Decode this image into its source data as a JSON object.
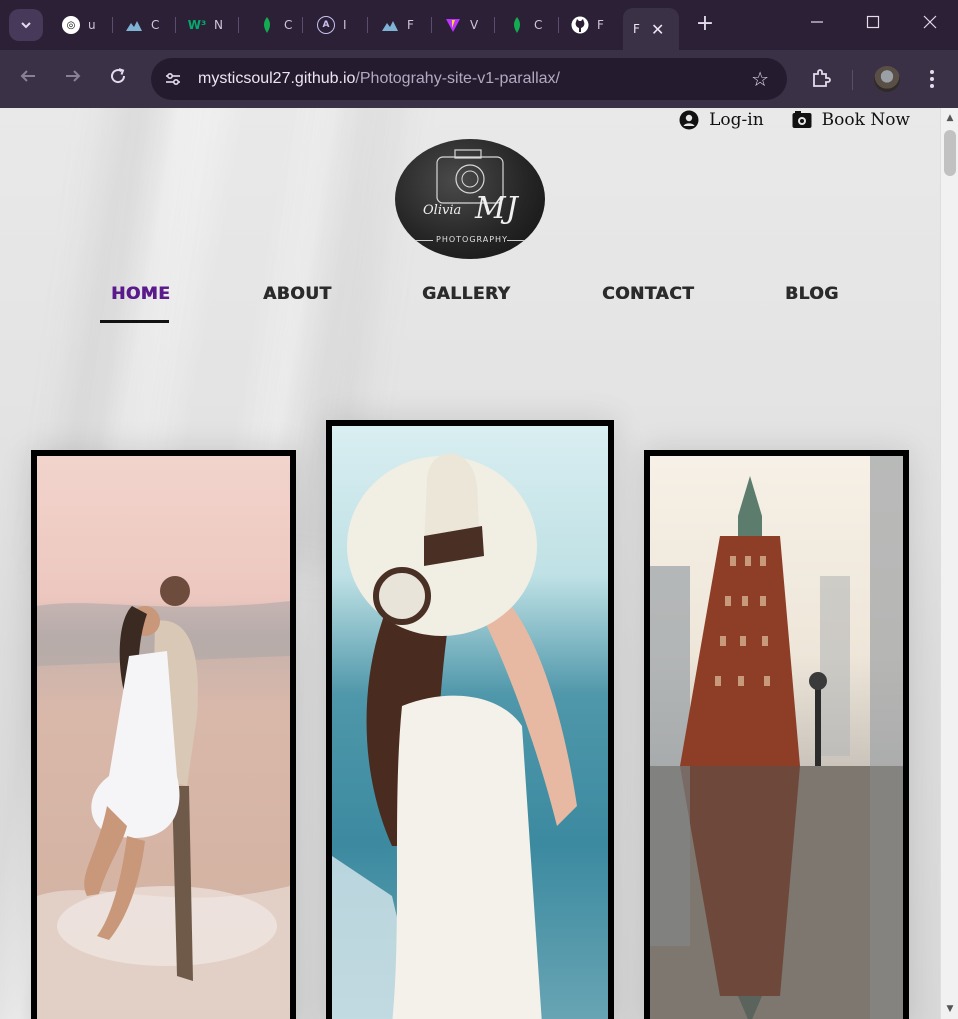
{
  "browser": {
    "tabs": [
      {
        "title": "u",
        "icon": "openai-icon",
        "color": "#ffffff"
      },
      {
        "title": "C",
        "icon": "mountain-icon",
        "color": "#7fb3d5"
      },
      {
        "title": "N",
        "icon": "w3-icon",
        "color": "#04aa6d"
      },
      {
        "title": "C",
        "icon": "mongodb-icon",
        "color": "#13aa52"
      },
      {
        "title": "I",
        "icon": "angular-icon",
        "color": "#c8c0f0"
      },
      {
        "title": "F",
        "icon": "mountain-icon",
        "color": "#7fb3d5"
      },
      {
        "title": "V",
        "icon": "vite-icon",
        "color": "#bd34fe"
      },
      {
        "title": "C",
        "icon": "mongodb-icon",
        "color": "#13aa52"
      },
      {
        "title": "F",
        "icon": "github-icon",
        "color": "#ffffff"
      }
    ],
    "active_tab_title": "F",
    "url_host": "mysticsoul27.github.io",
    "url_path": "/Photograhy-site-v1-parallax/"
  },
  "site": {
    "login_label": "Log-in",
    "book_label": "Book Now",
    "logo": {
      "script_name": "Olivia",
      "initials": "MJ",
      "tagline": "PHOTOGRAPHY"
    },
    "nav": [
      {
        "label": "HOME",
        "active": true
      },
      {
        "label": "ABOUT",
        "active": false
      },
      {
        "label": "GALLERY",
        "active": false
      },
      {
        "label": "CONTACT",
        "active": false
      },
      {
        "label": "BLOG",
        "active": false
      }
    ],
    "accent_color": "#5a1a8c",
    "photos": [
      {
        "subject": "couple-on-beach-photo"
      },
      {
        "subject": "woman-in-sun-hat-photo"
      },
      {
        "subject": "city-street-rain-reflection-photo"
      }
    ]
  }
}
